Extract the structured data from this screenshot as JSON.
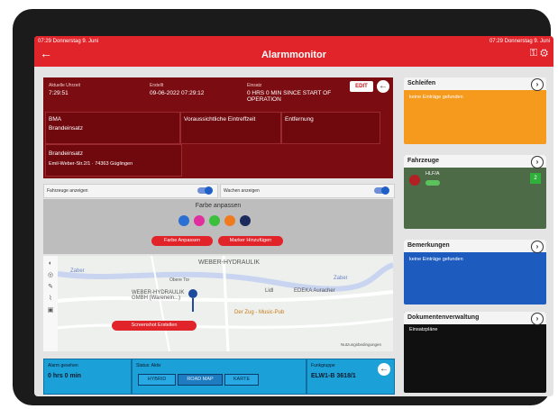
{
  "status_bar": {
    "left": "07:29 Donnerstag 9. Juni",
    "right": "07:29 Donnerstag 9. Juni"
  },
  "header": {
    "title": "Alarmmonitor",
    "back_icon": "←"
  },
  "info": {
    "current_time_label": "Aktuelle Uhrzeit",
    "current_time": "7:29:51",
    "created_label": "Erstellt",
    "created": "09-06-2022 07:29:12",
    "deployment_label": "Einsatz",
    "deployment": "0 HRS 0 MIN SINCE START OF OPERATION",
    "edit_label": "EDIT",
    "bma_label": "BMA",
    "bma_value": "Brandeinsatz",
    "eta_label": "Voraussichtliche Eintreffzeit",
    "distance_label": "Entfernung",
    "type_label": "Brandeinsatz",
    "address": "Emil-Weber-Str.2/1 · 74363 Güglingen"
  },
  "toggles": {
    "vehicles": "Fahrzeuge anzeigen",
    "stations": "Wachen anzeigen"
  },
  "colors": {
    "title": "Farbe anpassen",
    "swatches": [
      "#2a6fd1",
      "#e02e9c",
      "#3cc03c",
      "#f07a1e",
      "#1d2a5c"
    ],
    "apply": "Farbe Anpassen",
    "marker": "Marker Hinzufügen"
  },
  "map": {
    "labels": [
      "WEBER-HYDRAULIK",
      "Zaber",
      "Zaber",
      "WEBER-HYDRAULIK GMBH (Warenein...)",
      "Lidl",
      "EDEKA Auracher",
      "Der Zug - Music-Pub",
      "Obere Tor",
      "Nutzungsbedingungen"
    ],
    "screenshot": "Screenshot Erstellen"
  },
  "bottom": {
    "alarm_label": "Alarm gesehen",
    "alarm_value": "0 hrs 0 min",
    "status_label": "Status: Aktiv",
    "map_types": [
      "HYBRID",
      "ROAD MAP",
      "KARTE"
    ],
    "radio_label": "Funkgruppe",
    "radio_value": "ELW1-B 3618/1"
  },
  "cards": {
    "loops": {
      "title": "Schleifen",
      "empty": "keine Einträge gefunden"
    },
    "vehicles": {
      "title": "Fahrzeuge",
      "vehicle": "HLF/A",
      "badge": "2"
    },
    "remarks": {
      "title": "Bemerkungen",
      "empty": "keine Einträge gefunden"
    },
    "documents": {
      "title": "Dokumentenverwaltung",
      "sub": "Einsatzpläne"
    }
  }
}
